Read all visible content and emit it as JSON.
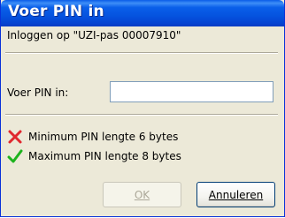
{
  "window": {
    "title": "Voer PIN in"
  },
  "dialog": {
    "description": "Inloggen op \"UZI-pas 00007910\"",
    "pin_label": "Voer PIN in:",
    "pin_value": ""
  },
  "rules": [
    {
      "icon": "red-cross-icon",
      "text": "Minimum PIN lengte 6 bytes",
      "color": "#e0282e"
    },
    {
      "icon": "green-check-icon",
      "text": "Maximum PIN lengte 8 bytes",
      "color": "#1db31d"
    }
  ],
  "buttons": {
    "ok_label": "OK",
    "cancel_label": "Annuleren"
  }
}
